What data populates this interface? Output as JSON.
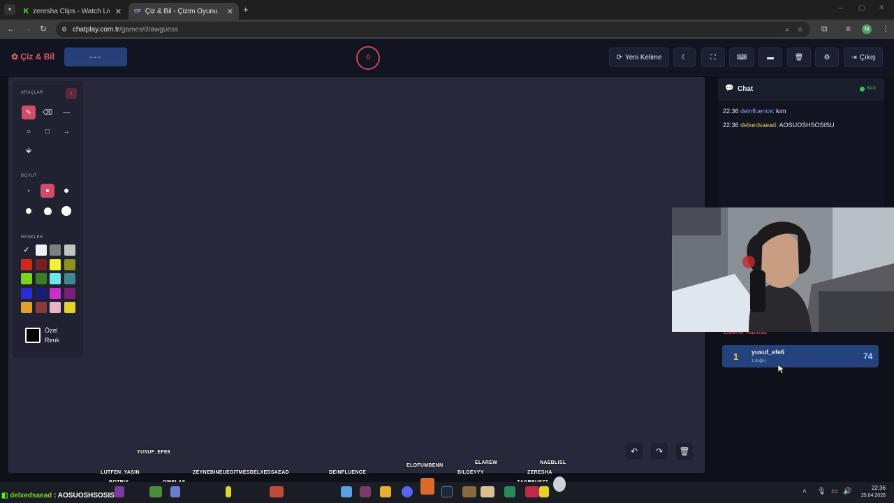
{
  "browser": {
    "tabs": [
      {
        "favicon": "K",
        "title": "zeresha Clips - Watch Live on K",
        "active": false
      },
      {
        "favicon": "CP",
        "title": "Çiz & Bil - Çizim Oyunu",
        "active": true
      }
    ],
    "url_host": "chatplay.com.tr",
    "url_path": "/games/drawguess"
  },
  "header": {
    "logo": "Çiz & Bil",
    "word_hint": "---",
    "timer": "0",
    "buttons": {
      "new_word": "Yeni Kelime",
      "exit": "Çıkış"
    }
  },
  "tools": {
    "section_tools": "ARAÇLAR",
    "section_size": "BOYUT",
    "section_colors": "RENKLER",
    "custom_color_line1": "Özel",
    "custom_color_line2": "Renk",
    "colors": [
      "#ffffff",
      "#f2f2f2",
      "#7f7f7f",
      "#c3c3c3",
      "#cc2a1a",
      "#7a1f1f",
      "#f5f033",
      "#8e911e",
      "#7ed321",
      "#3a7d2a",
      "#6ee3ea",
      "#3e8a8a",
      "#2a2ad6",
      "#1b1b7a",
      "#c930c9",
      "#7a1f7a",
      "#e0a12a",
      "#8a3a3a",
      "#eab4c4",
      "#e3d22a"
    ]
  },
  "chat": {
    "title": "Chat",
    "status": "Kick",
    "messages": [
      {
        "time": "22:36",
        "user": "deinfluence",
        "text": "kım",
        "color": "#7fa6ff"
      },
      {
        "time": "22:36",
        "user": "delxedsaead",
        "text": "AOSUOSHSOSISU",
        "color": "#e8c86a"
      }
    ]
  },
  "leaderboard": {
    "title": "Liderlik Tablosu",
    "entries": [
      {
        "rank": "1",
        "name": "yusuf_efe6",
        "sub": "1 doğru",
        "score": "74"
      }
    ]
  },
  "overlay_names": [
    "YUSUF_EFE6",
    "LUTFEN_YASIN",
    "BOTRIX",
    "OWELAS",
    "ZEYNEBINEUEGITMESDELXEDSAEAD",
    "DEINFLUENCE",
    "ELOFUMBENN",
    "ELAREW",
    "NAEBLISL",
    "BILGEYYY",
    "ZERESHA",
    "ZAGREUS77"
  ],
  "chat_overlay": {
    "user": "delxedsaead",
    "text": "AOSUOSHSOSISU"
  },
  "taskbar": {
    "time": "22:36",
    "date": "25.04.2026"
  },
  "accent": "#d04e65"
}
